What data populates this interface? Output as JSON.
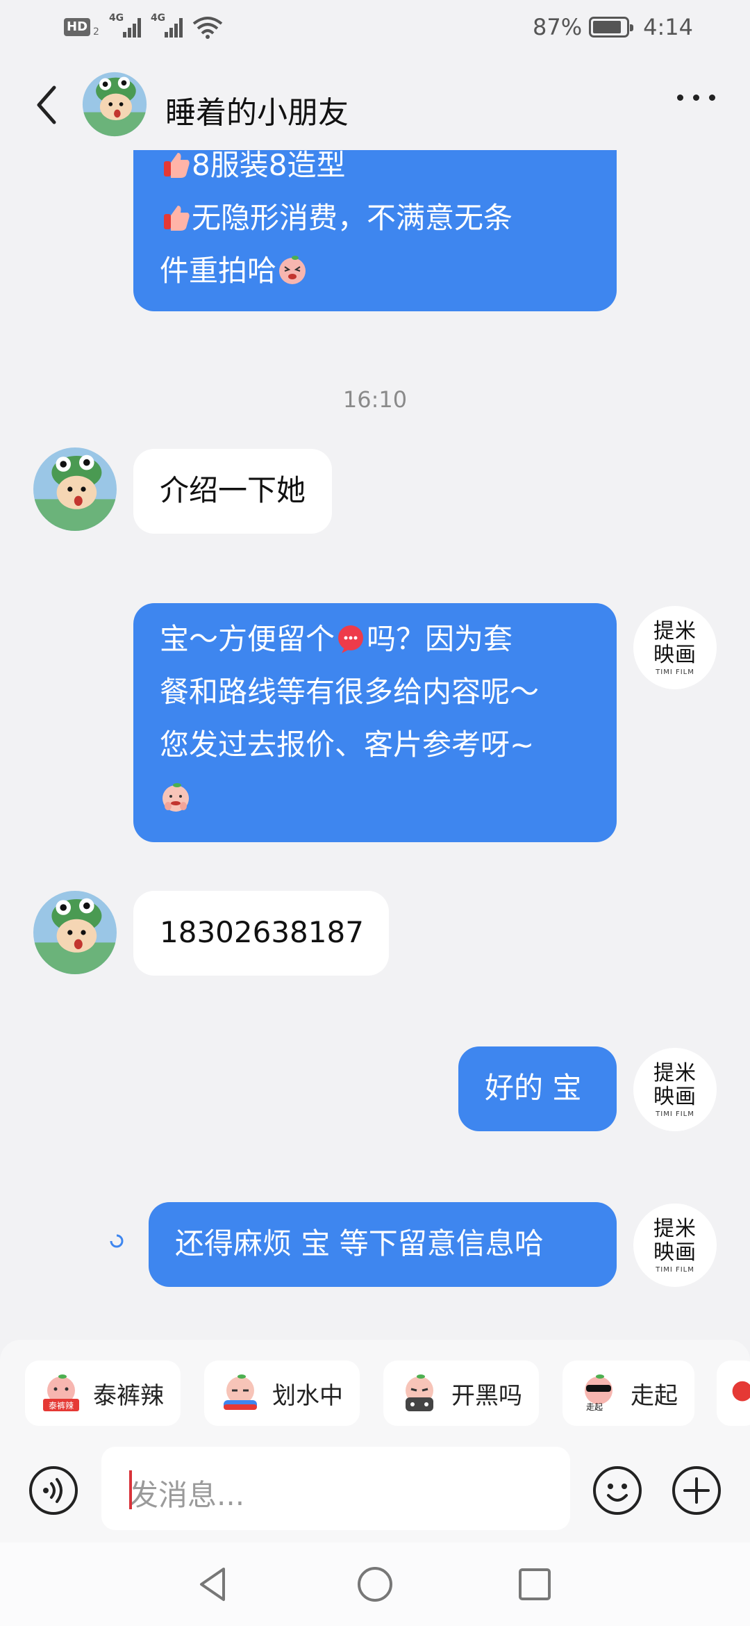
{
  "status_bar": {
    "hd_label": "HD",
    "hd_sub": "2",
    "signal1_label": "4G",
    "signal2_label": "4G",
    "battery_percent": "87%",
    "battery_level": 0.87,
    "time": "4:14"
  },
  "header": {
    "title": "睡着的小朋友"
  },
  "messages": {
    "first_line1": "8服装8造型",
    "first_line2": "无隐形消费，不满意无条",
    "first_line3": "件重拍哈",
    "timestamp": "16:10",
    "in1": "介绍一下她",
    "out1_line1_a": "宝～方便留个",
    "out1_line1_b": "吗？因为套",
    "out1_line2": "餐和路线等有很多给内容呢～",
    "out1_line3": "您发过去报价、客片参考呀~",
    "in2": "18302638187",
    "out2": "好的 宝",
    "out3": "还得麻烦 宝 等下留意信息哈"
  },
  "out_avatar": {
    "logo_line1": "提米",
    "logo_line2": "映画",
    "logo_sub": "TIMI FILM"
  },
  "quick_replies": [
    {
      "label": "泰裤辣",
      "sticker_text": "泰裤辣"
    },
    {
      "label": "划水中"
    },
    {
      "label": "开黑吗"
    },
    {
      "label": "走起",
      "sticker_text": "走起"
    }
  ],
  "input": {
    "placeholder": "发消息..."
  },
  "icons": {
    "back": "chevron-left-icon",
    "more": "more-dots-icon",
    "voice": "voice-icon",
    "emoji": "smiley-icon",
    "plus": "plus-circle-icon",
    "nav_back": "triangle-back-icon",
    "nav_home": "circle-home-icon",
    "nav_recent": "square-recent-icon"
  },
  "colors": {
    "outgoing_bubble": "#3e86ef",
    "incoming_bubble": "#ffffff",
    "background": "#f2f2f4",
    "caret": "#d8333a"
  }
}
